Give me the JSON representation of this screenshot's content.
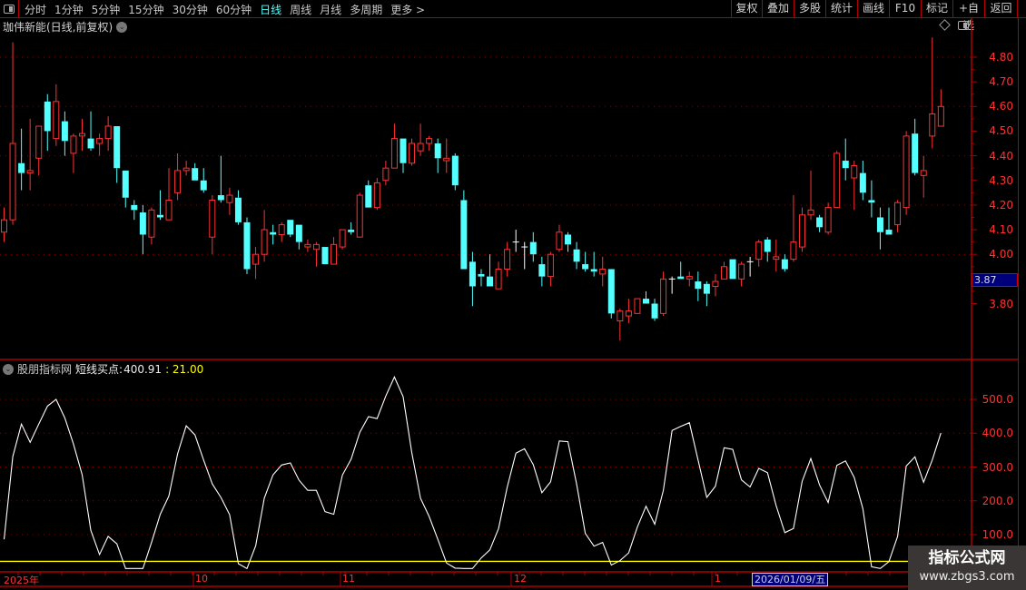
{
  "toolbar": {
    "periods": [
      "分时",
      "1分钟",
      "5分钟",
      "15分钟",
      "30分钟",
      "60分钟",
      "日线",
      "周线",
      "月线",
      "多周期",
      "更多 >"
    ],
    "active_period": "日线",
    "actions": [
      "复权",
      "叠加",
      "多股",
      "统计",
      "画线",
      "F10",
      "标记",
      "+自选",
      "返回"
    ]
  },
  "main": {
    "title": "珈伟新能(日线,前复权)",
    "current_price_label": "3.87"
  },
  "indicator": {
    "source": "股朋指标网",
    "name": "短线买点:",
    "value": "400.91",
    "ref_value": ": 21.00"
  },
  "time_axis": {
    "labels": [
      "2025年",
      "10",
      "11",
      "12",
      "1"
    ],
    "cursor_date": "2026/01/09/五"
  },
  "watermark": {
    "title": "指标公式网",
    "url": "www.zbgs3.com"
  },
  "colors": {
    "up": "#ff3232",
    "down": "#54ffff",
    "flat": "#ffffff",
    "indicator_line": "#ffffff",
    "ref_line": "#ffff00",
    "grid": "#8a0000",
    "axis": "#ff3232"
  },
  "chart_data": [
    {
      "type": "candlestick",
      "y_ticks": [
        "4.80",
        "4.70",
        "4.60",
        "4.50",
        "4.40",
        "4.30",
        "4.20",
        "4.10",
        "4.00",
        "3.80"
      ],
      "grid": true,
      "ohlc": [
        [
          4.09,
          4.19,
          4.05,
          4.14
        ],
        [
          4.14,
          4.86,
          4.12,
          4.45
        ],
        [
          4.37,
          4.51,
          4.26,
          4.33
        ],
        [
          4.33,
          4.55,
          4.26,
          4.34
        ],
        [
          4.39,
          4.52,
          4.32,
          4.52
        ],
        [
          4.62,
          4.65,
          4.42,
          4.5
        ],
        [
          4.47,
          4.69,
          4.44,
          4.62
        ],
        [
          4.54,
          4.58,
          4.4,
          4.46
        ],
        [
          4.41,
          4.49,
          4.33,
          4.48
        ],
        [
          4.48,
          4.55,
          4.42,
          4.49
        ],
        [
          4.47,
          4.58,
          4.42,
          4.43
        ],
        [
          4.45,
          4.49,
          4.4,
          4.47
        ],
        [
          4.47,
          4.56,
          4.42,
          4.52
        ],
        [
          4.52,
          4.52,
          4.29,
          4.35
        ],
        [
          4.34,
          4.34,
          4.19,
          4.23
        ],
        [
          4.2,
          4.22,
          4.14,
          4.18
        ],
        [
          4.17,
          4.2,
          4.0,
          4.08
        ],
        [
          4.07,
          4.19,
          4.04,
          4.18
        ],
        [
          4.16,
          4.26,
          4.14,
          4.15
        ],
        [
          4.14,
          4.35,
          4.14,
          4.22
        ],
        [
          4.25,
          4.41,
          4.22,
          4.34
        ],
        [
          4.34,
          4.38,
          4.32,
          4.35
        ],
        [
          4.35,
          4.37,
          4.3,
          4.3
        ],
        [
          4.3,
          4.35,
          4.25,
          4.26
        ],
        [
          4.07,
          4.24,
          4.0,
          4.22
        ],
        [
          4.24,
          4.4,
          4.21,
          4.22
        ],
        [
          4.21,
          4.27,
          4.16,
          4.24
        ],
        [
          4.23,
          4.26,
          4.12,
          4.13
        ],
        [
          4.13,
          4.15,
          3.92,
          3.94
        ],
        [
          3.96,
          4.03,
          3.9,
          4.0
        ],
        [
          4.0,
          4.18,
          3.97,
          4.1
        ],
        [
          4.09,
          4.12,
          4.04,
          4.08
        ],
        [
          4.08,
          4.13,
          4.05,
          4.12
        ],
        [
          4.14,
          4.14,
          4.07,
          4.08
        ],
        [
          4.12,
          4.12,
          4.02,
          4.05
        ],
        [
          4.03,
          4.06,
          4.01,
          4.04
        ],
        [
          4.02,
          4.05,
          3.95,
          4.04
        ],
        [
          4.03,
          4.03,
          3.96,
          3.96
        ],
        [
          3.96,
          4.07,
          3.96,
          4.04
        ],
        [
          4.03,
          4.1,
          4.02,
          4.1
        ],
        [
          4.1,
          4.13,
          4.08,
          4.09
        ],
        [
          4.07,
          4.25,
          4.07,
          4.24
        ],
        [
          4.28,
          4.3,
          4.19,
          4.19
        ],
        [
          4.19,
          4.31,
          4.18,
          4.29
        ],
        [
          4.3,
          4.38,
          4.28,
          4.35
        ],
        [
          4.35,
          4.53,
          4.35,
          4.47
        ],
        [
          4.47,
          4.47,
          4.33,
          4.37
        ],
        [
          4.37,
          4.47,
          4.36,
          4.45
        ],
        [
          4.42,
          4.53,
          4.4,
          4.45
        ],
        [
          4.45,
          4.48,
          4.42,
          4.47
        ],
        [
          4.45,
          4.47,
          4.33,
          4.39
        ],
        [
          4.38,
          4.47,
          4.33,
          4.39
        ],
        [
          4.4,
          4.41,
          4.26,
          4.28
        ],
        [
          4.22,
          4.26,
          3.94,
          3.94
        ],
        [
          3.97,
          4.01,
          3.79,
          3.87
        ],
        [
          3.92,
          3.94,
          3.87,
          3.91
        ],
        [
          3.91,
          4.0,
          3.87,
          3.87
        ],
        [
          3.86,
          3.97,
          3.86,
          3.94
        ],
        [
          3.94,
          4.05,
          3.91,
          4.02
        ],
        [
          4.05,
          4.1,
          4.01,
          4.05
        ],
        [
          4.03,
          4.05,
          3.94,
          4.03
        ],
        [
          4.05,
          4.09,
          3.97,
          4.0
        ],
        [
          3.96,
          3.99,
          3.87,
          3.91
        ],
        [
          3.91,
          4.01,
          3.87,
          4.0
        ],
        [
          4.02,
          4.12,
          4.01,
          4.09
        ],
        [
          4.08,
          4.09,
          4.01,
          4.04
        ],
        [
          4.02,
          4.05,
          3.94,
          3.97
        ],
        [
          3.96,
          4.01,
          3.93,
          3.94
        ],
        [
          3.94,
          4.01,
          3.91,
          3.93
        ],
        [
          3.92,
          3.99,
          3.87,
          3.94
        ],
        [
          3.94,
          3.94,
          3.74,
          3.76
        ],
        [
          3.73,
          3.78,
          3.65,
          3.77
        ],
        [
          3.75,
          3.82,
          3.72,
          3.77
        ],
        [
          3.76,
          3.82,
          3.76,
          3.82
        ],
        [
          3.82,
          3.85,
          3.8,
          3.8
        ],
        [
          3.8,
          3.82,
          3.73,
          3.74
        ],
        [
          3.76,
          3.93,
          3.75,
          3.9
        ],
        [
          3.9,
          3.91,
          3.84,
          3.9
        ],
        [
          3.91,
          3.97,
          3.9,
          3.9
        ],
        [
          3.9,
          3.93,
          3.87,
          3.91
        ],
        [
          3.89,
          3.93,
          3.81,
          3.86
        ],
        [
          3.88,
          3.89,
          3.79,
          3.84
        ],
        [
          3.87,
          3.92,
          3.83,
          3.89
        ],
        [
          3.9,
          3.97,
          3.9,
          3.95
        ],
        [
          3.98,
          3.98,
          3.9,
          3.9
        ],
        [
          3.9,
          3.97,
          3.87,
          3.96
        ],
        [
          3.97,
          3.99,
          3.91,
          3.97
        ],
        [
          3.98,
          4.06,
          3.95,
          4.05
        ],
        [
          4.06,
          4.07,
          3.97,
          4.01
        ],
        [
          3.98,
          4.06,
          3.93,
          3.99
        ],
        [
          3.98,
          4.0,
          3.93,
          3.94
        ],
        [
          3.98,
          4.24,
          3.97,
          4.05
        ],
        [
          4.03,
          4.19,
          4.01,
          4.16
        ],
        [
          4.16,
          4.34,
          4.14,
          4.18
        ],
        [
          4.15,
          4.16,
          4.09,
          4.11
        ],
        [
          4.09,
          4.21,
          4.08,
          4.19
        ],
        [
          4.19,
          4.42,
          4.19,
          4.41
        ],
        [
          4.38,
          4.47,
          4.3,
          4.35
        ],
        [
          4.31,
          4.38,
          4.18,
          4.36
        ],
        [
          4.33,
          4.38,
          4.22,
          4.25
        ],
        [
          4.22,
          4.3,
          4.15,
          4.21
        ],
        [
          4.15,
          4.19,
          4.02,
          4.09
        ],
        [
          4.1,
          4.19,
          4.08,
          4.08
        ],
        [
          4.12,
          4.22,
          4.09,
          4.21
        ],
        [
          4.19,
          4.5,
          4.16,
          4.48
        ],
        [
          4.49,
          4.55,
          4.32,
          4.33
        ],
        [
          4.32,
          4.4,
          4.23,
          4.34
        ],
        [
          4.48,
          4.88,
          4.43,
          4.57
        ],
        [
          4.52,
          4.67,
          4.52,
          4.6
        ]
      ]
    },
    {
      "type": "line",
      "y_ticks": [
        "500.0",
        "400.0",
        "300.0",
        "200.0",
        "100.0"
      ],
      "grid": true,
      "series": [
        {
          "name": "短线买点",
          "values": [
            86,
            331,
            427,
            373,
            427,
            480,
            500,
            445,
            368,
            277,
            113,
            41,
            95,
            73,
            0,
            0,
            0,
            77,
            160,
            214,
            339,
            422,
            395,
            321,
            250,
            210,
            159,
            14,
            0,
            67,
            208,
            277,
            306,
            312,
            261,
            231,
            231,
            168,
            160,
            276,
            323,
            402,
            449,
            443,
            510,
            566,
            508,
            343,
            208,
            154,
            86,
            16,
            1,
            0,
            0,
            31,
            55,
            118,
            240,
            341,
            354,
            307,
            224,
            256,
            377,
            375,
            249,
            104,
            66,
            77,
            10,
            23,
            46,
            122,
            184,
            131,
            231,
            408,
            420,
            431,
            321,
            210,
            243,
            357,
            352,
            262,
            241,
            296,
            283,
            186,
            106,
            118,
            258,
            325,
            247,
            195,
            305,
            318,
            269,
            177,
            5,
            0,
            20,
            95,
            303,
            330,
            255,
            321,
            400.91
          ]
        }
      ],
      "reference_line": 21.0
    }
  ]
}
